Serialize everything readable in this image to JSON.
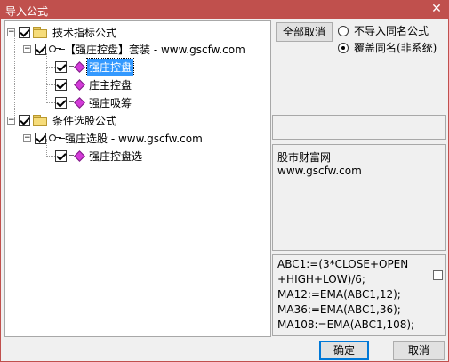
{
  "window": {
    "title": "导入公式",
    "close_glyph": "✕"
  },
  "tree": {
    "nodes": [
      {
        "label": "技术指标公式"
      },
      {
        "label": "【强庄控盘】套装 - www.gscfw.com"
      },
      {
        "label": "强庄控盘",
        "selected": true
      },
      {
        "label": "庄主控盘"
      },
      {
        "label": "强庄吸筹"
      },
      {
        "label": "条件选股公式"
      },
      {
        "label": "强庄选股 - www.gscfw.com"
      },
      {
        "label": "强庄控盘选"
      }
    ]
  },
  "buttons": {
    "cancel_all": "全部取消",
    "ok": "确定",
    "cancel": "取消"
  },
  "options": {
    "no_import_same_name": "不导入同名公式",
    "overwrite_same_name": "覆盖同名(非系统)"
  },
  "info": {
    "line1": "股市财富网",
    "line2": "www.gscfw.com"
  },
  "code": [
    "ABC1:=(3*CLOSE+OPEN",
    "+HIGH+LOW)/6;",
    "MA12:=EMA(ABC1,12);",
    "MA36:=EMA(ABC1,36);",
    "MA108:=EMA(ABC1,108);"
  ]
}
